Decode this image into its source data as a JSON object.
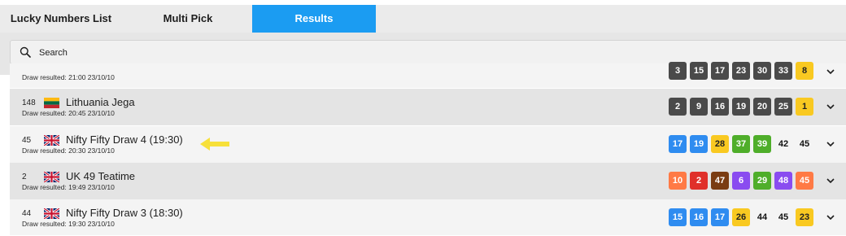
{
  "tabs": [
    {
      "label": "Lucky Numbers List",
      "active": false
    },
    {
      "label": "Multi Pick",
      "active": false
    },
    {
      "label": "Results",
      "active": true
    }
  ],
  "search": {
    "placeholder": "Search",
    "value": ""
  },
  "colors": {
    "accent": "#1b9cf2",
    "dark": "#4a4a4a",
    "yellow": "#f9c921",
    "blue": "#2f8cf0",
    "green": "#4fae2a",
    "orange": "#ff7a45",
    "red": "#e0302a",
    "brown": "#7a3c12",
    "purple": "#8a4cf0"
  },
  "draws": [
    {
      "id": "",
      "flag": "",
      "title": "",
      "subtitle": "Draw resulted: 21:00 23/10/10",
      "balls": [
        {
          "n": "3",
          "c": "dark"
        },
        {
          "n": "15",
          "c": "dark"
        },
        {
          "n": "17",
          "c": "dark"
        },
        {
          "n": "23",
          "c": "dark"
        },
        {
          "n": "30",
          "c": "dark"
        },
        {
          "n": "33",
          "c": "dark"
        },
        {
          "n": "8",
          "c": "yellow"
        }
      ]
    },
    {
      "id": "148",
      "flag": "lithuania-flag-icon",
      "title": "Lithuania Jega",
      "subtitle": "Draw resulted: 20:45 23/10/10",
      "balls": [
        {
          "n": "2",
          "c": "dark"
        },
        {
          "n": "9",
          "c": "dark"
        },
        {
          "n": "16",
          "c": "dark"
        },
        {
          "n": "19",
          "c": "dark"
        },
        {
          "n": "20",
          "c": "dark"
        },
        {
          "n": "25",
          "c": "dark"
        },
        {
          "n": "1",
          "c": "yellow"
        }
      ]
    },
    {
      "id": "45",
      "flag": "uk-flag-icon",
      "title": "Nifty Fifty Draw 4 (19:30)",
      "subtitle": "Draw resulted: 20:30 23/10/10",
      "balls": [
        {
          "n": "17",
          "c": "blue"
        },
        {
          "n": "19",
          "c": "blue"
        },
        {
          "n": "28",
          "c": "yellow"
        },
        {
          "n": "37",
          "c": "green"
        },
        {
          "n": "39",
          "c": "green"
        },
        {
          "n": "42",
          "c": "white"
        },
        {
          "n": "45",
          "c": "white"
        }
      ]
    },
    {
      "id": "2",
      "flag": "uk-flag-icon",
      "title": "UK 49 Teatime",
      "subtitle": "Draw resulted: 19:49 23/10/10",
      "balls": [
        {
          "n": "10",
          "c": "orange"
        },
        {
          "n": "2",
          "c": "red"
        },
        {
          "n": "47",
          "c": "brown"
        },
        {
          "n": "6",
          "c": "purple"
        },
        {
          "n": "29",
          "c": "green"
        },
        {
          "n": "48",
          "c": "purple"
        },
        {
          "n": "45",
          "c": "orange"
        }
      ]
    },
    {
      "id": "44",
      "flag": "uk-flag-icon",
      "title": "Nifty Fifty Draw 3 (18:30)",
      "subtitle": "Draw resulted: 19:30 23/10/10",
      "balls": [
        {
          "n": "15",
          "c": "blue"
        },
        {
          "n": "16",
          "c": "blue"
        },
        {
          "n": "17",
          "c": "blue"
        },
        {
          "n": "26",
          "c": "yellow"
        },
        {
          "n": "44",
          "c": "white"
        },
        {
          "n": "45",
          "c": "white"
        },
        {
          "n": "23",
          "c": "yellow"
        }
      ]
    }
  ]
}
